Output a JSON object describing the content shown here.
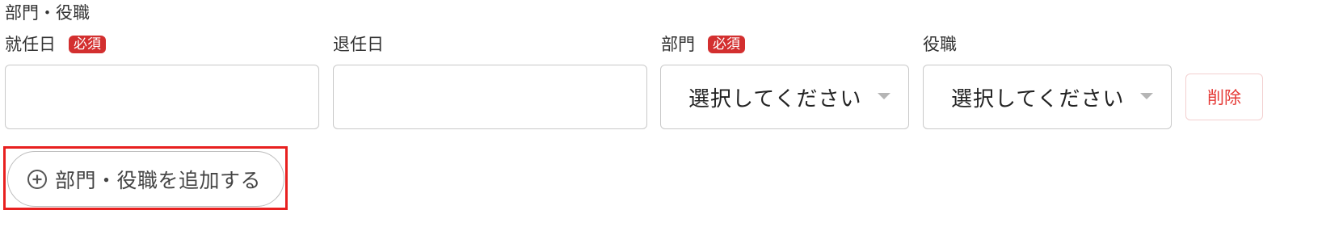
{
  "section": {
    "title": "部門・役職"
  },
  "fields": {
    "start_date": {
      "label": "就任日",
      "badge": "必須",
      "value": ""
    },
    "end_date": {
      "label": "退任日",
      "value": ""
    },
    "department": {
      "label": "部門",
      "badge": "必須",
      "selected": "選択してください"
    },
    "position": {
      "label": "役職",
      "selected": "選択してください"
    }
  },
  "actions": {
    "delete_label": "削除",
    "add_label": "部門・役職を追加する"
  },
  "colors": {
    "required_badge": "#d32f2f",
    "delete_text": "#e53935",
    "highlight_frame": "#e8201f",
    "border": "#c9c9c9"
  },
  "icons": {
    "add": "plus-circle-icon",
    "select_caret": "caret-down-icon"
  }
}
